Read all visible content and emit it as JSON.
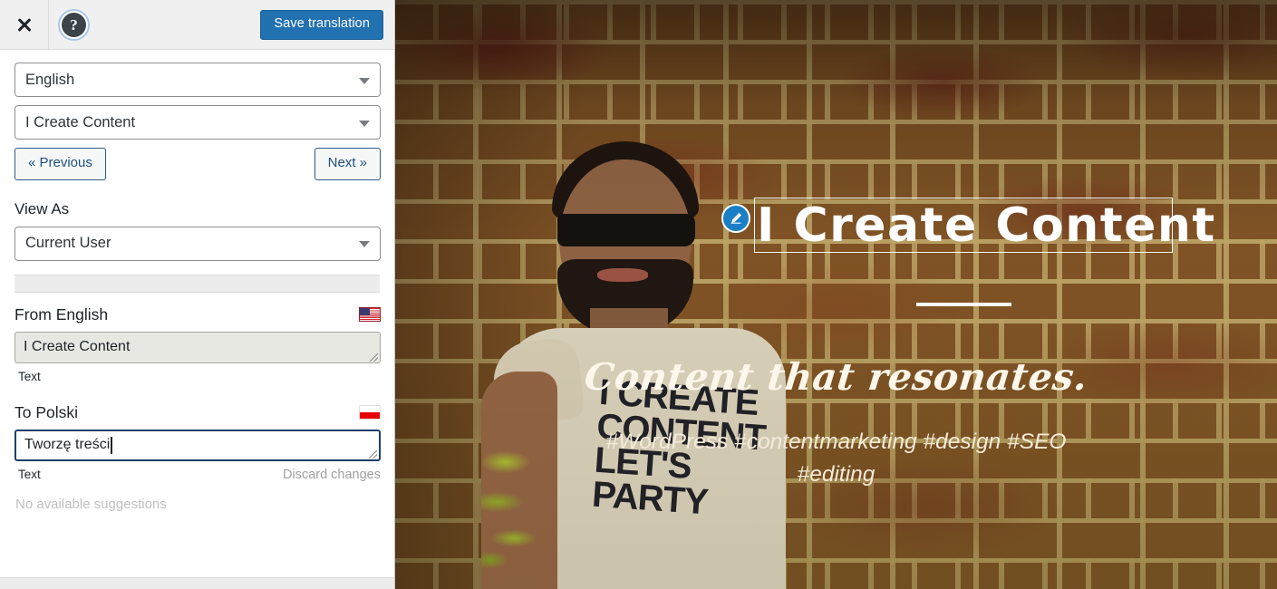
{
  "sidebar": {
    "topbar": {
      "close_icon": "close-icon",
      "help_icon": "help-icon",
      "help_glyph": "?",
      "save_label": "Save translation",
      "accent_color": "#2271b1"
    },
    "language_select": {
      "value": "English",
      "caret_icon": "chevron-down-icon"
    },
    "string_select": {
      "value": "I Create Content",
      "caret_icon": "chevron-down-icon"
    },
    "nav": {
      "previous_label": "« Previous",
      "next_label": "Next »"
    },
    "view_as": {
      "label": "View As",
      "value": "Current User",
      "caret_icon": "chevron-down-icon"
    },
    "source": {
      "title": "From English",
      "flag_icon": "flag-us-icon",
      "value": "I Create Content",
      "type_label": "Text"
    },
    "target": {
      "title": "To Polski",
      "flag_icon": "flag-pl-icon",
      "value": "Tworzę treści",
      "type_label": "Text",
      "discard_label": "Discard changes",
      "suggestions": "No available suggestions"
    }
  },
  "preview": {
    "edit_icon": "pencil-icon",
    "hero_title": "I Create Content",
    "hero_script": "Content that resonates.",
    "hero_tags": "#WordPress #contentmarketing #design #SEO #editing",
    "shirt_text": "I Create Content Let's Party"
  }
}
